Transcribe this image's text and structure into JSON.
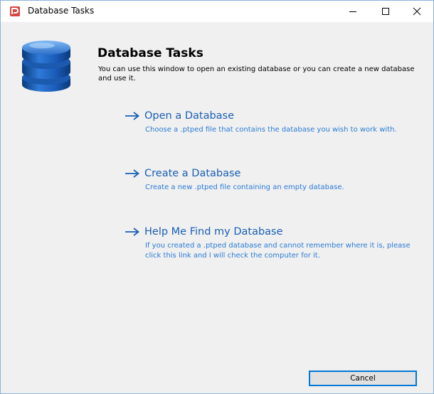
{
  "window": {
    "title": "Database Tasks"
  },
  "header": {
    "title": "Database Tasks",
    "description": "You can use this window to open an existing database or you can create a new database and use it."
  },
  "tasks": [
    {
      "title": "Open a Database",
      "description": "Choose a .ptped file that contains the database you wish to work with."
    },
    {
      "title": "Create a Database",
      "description": "Create a new .ptped file containing an empty database."
    },
    {
      "title": "Help Me Find my Database",
      "description": "If you created a .ptped database and cannot remember where it is, please click this link and I will check the computer for it."
    }
  ],
  "footer": {
    "cancel_label": "Cancel"
  },
  "colors": {
    "link": "#1a5fb4",
    "link_description": "#2a7bd5",
    "focus_border": "#0078d7",
    "app_icon": "#c0392b"
  },
  "icons": {
    "app": "app-logo-icon",
    "database": "database-icon",
    "task_arrow": "right-arrow-icon"
  }
}
